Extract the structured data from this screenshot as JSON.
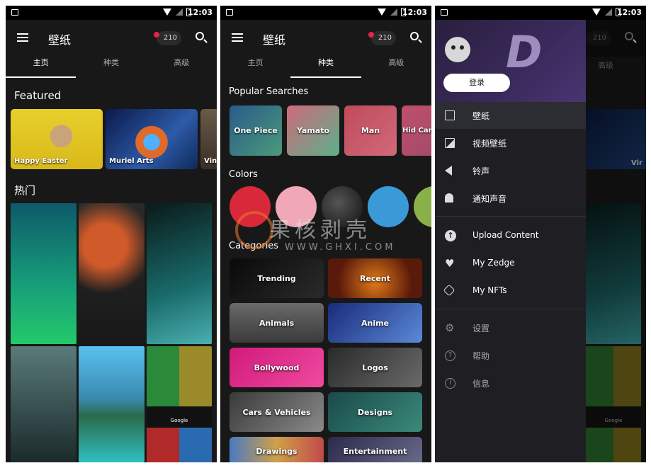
{
  "status": {
    "time": "12:03"
  },
  "screen1": {
    "title": "壁纸",
    "credits": "210",
    "tabs": [
      "主页",
      "种类",
      "高级"
    ],
    "featured_label": "Featured",
    "featured": [
      {
        "label": "Happy Easter"
      },
      {
        "label": "Muriel Arts"
      },
      {
        "label": "Vin"
      }
    ],
    "hot_label": "热门",
    "google_text": "Google"
  },
  "screen2": {
    "title": "壁纸",
    "credits": "210",
    "tabs": [
      "主页",
      "种类",
      "高级"
    ],
    "popular_label": "Popular Searches",
    "popular": [
      "One Piece",
      "Yamato",
      "Man",
      "Hid Cam"
    ],
    "colors_label": "Colors",
    "categories_label": "Categories",
    "categories": [
      "Trending",
      "Recent",
      "Animals",
      "Anime",
      "Bollywood",
      "Logos",
      "Cars & Vehicles",
      "Designs",
      "Drawings",
      "Entertainment"
    ]
  },
  "screen3": {
    "credits": "210",
    "tab": "高级",
    "login": "登录",
    "logo_text": "D",
    "menu": [
      "壁纸",
      "视频壁纸",
      "铃声",
      "通知声音"
    ],
    "menu2": [
      "Upload Content",
      "My Zedge",
      "My NFTs"
    ],
    "menu3": [
      "设置",
      "帮助",
      "信息"
    ],
    "peek_label": "Vir",
    "google_text": "Google"
  },
  "watermark": {
    "cn": "果核剥壳",
    "url": "WWW.GHXI.COM"
  },
  "colors": {
    "accent": "#e8234a",
    "background": "#181818",
    "drawer": "#1f1f23"
  },
  "icons": [
    "menu-icon",
    "search-icon",
    "image-icon",
    "video-icon",
    "volume-icon",
    "bell-icon",
    "upload-icon",
    "heart-icon",
    "nft-icon",
    "gear-icon",
    "help-icon",
    "info-icon"
  ]
}
